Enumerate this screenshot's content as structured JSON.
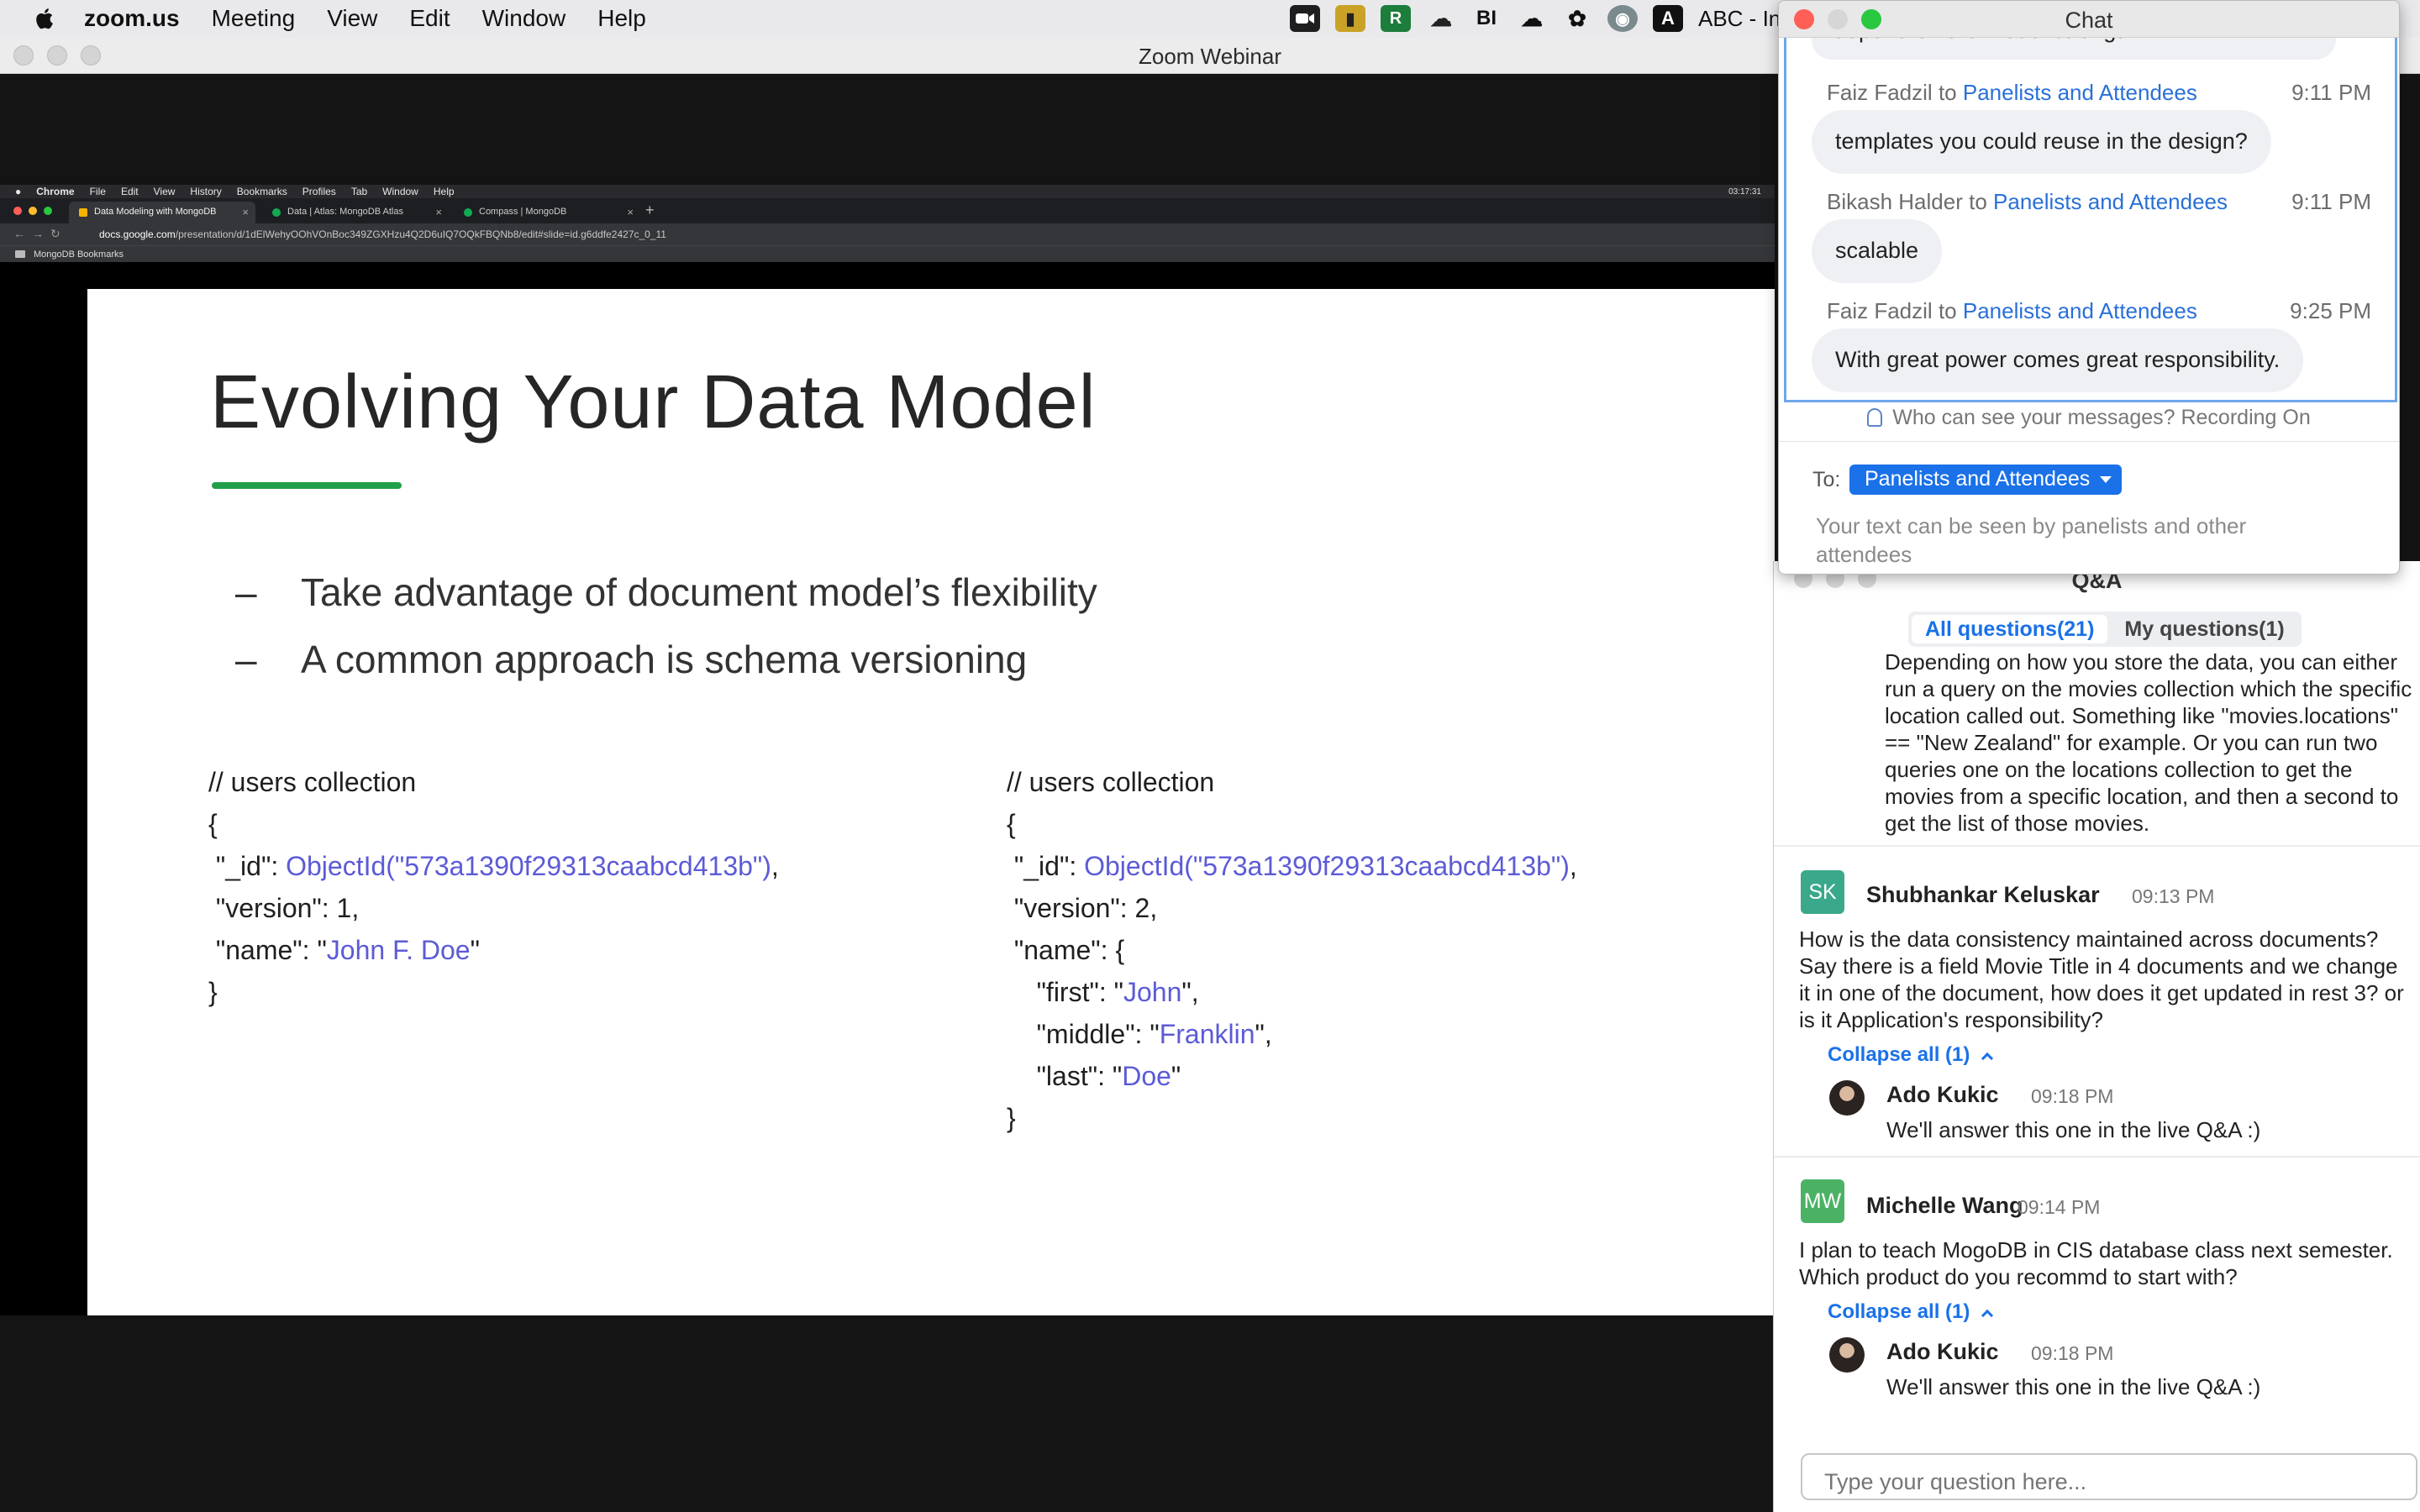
{
  "menubar": {
    "app": "zoom.us",
    "items": [
      "Meeting",
      "View",
      "Edit",
      "Window",
      "Help"
    ],
    "tray_icons": [
      "zoom-camera-icon",
      "shield-icon",
      "green-r-icon",
      "weather-icon",
      "bi-icon",
      "cloud-icon",
      "gear-badge-icon",
      "vpn-icon",
      "text-input-icon"
    ],
    "input_source": "ABC - In"
  },
  "zoom_window": {
    "title": "Zoom Webinar"
  },
  "chrome": {
    "menu": [
      "Chrome",
      "File",
      "Edit",
      "View",
      "History",
      "Bookmarks",
      "Profiles",
      "Tab",
      "Window",
      "Help"
    ],
    "clock": "03:17:31",
    "tabs": [
      {
        "label": "Data Modeling with MongoDB"
      },
      {
        "label": "Data | Atlas: MongoDB Atlas"
      },
      {
        "label": "Compass | MongoDB"
      }
    ],
    "url_host": "docs.google.com",
    "url_path": "/presentation/d/1dElWehyOOhVOnBoc349ZGXHzu4Q2D6uIQ7OQkFBQNb8/edit#slide=id.g6ddfe2427c_0_11",
    "bookmark": "MongoDB Bookmarks"
  },
  "slide": {
    "title": "Evolving Your Data Model",
    "bullets": [
      "Take advantage of document model’s flexibility",
      "A common approach is schema versioning"
    ],
    "left_code": {
      "comment": "// users collection",
      "open": "{",
      "id_key": " \"_id\": ",
      "id_val": "ObjectId(\"573a1390f29313caabcd413b\")",
      "version_line": " \"version\": 1,",
      "name_key": " \"name\": \"",
      "name_val": "John F. Doe",
      "quote": "\"",
      "close": "}"
    },
    "right_code": {
      "comment": "// users collection",
      "open": "{",
      "id_key": " \"_id\": ",
      "id_val": "ObjectId(\"573a1390f29313caabcd413b\")",
      "version_line": " \"version\": 2,",
      "name_open": " \"name\": {",
      "first_key": "    \"first\": \"",
      "first_val": "John",
      "middle_key": "    \"middle\": \"",
      "middle_val": "Franklin",
      "last_key": "    \"last\": \"",
      "last_val": "Doe",
      "comma_q": "\",",
      "q": "\"",
      "close": "}"
    }
  },
  "chat": {
    "title": "Chat",
    "prev_tail": "depend on the model strength",
    "messages": [
      {
        "sender": "Faiz Fadzil",
        "to_word": "to",
        "recipient": "Panelists and Attendees",
        "time": "9:11 PM",
        "text": "templates you could reuse in the design?"
      },
      {
        "sender": "Bikash Halder",
        "to_word": "to",
        "recipient": "Panelists and Attendees",
        "time": "9:11 PM",
        "text": "scalable"
      },
      {
        "sender": "Faiz Fadzil",
        "to_word": "to",
        "recipient": "Panelists and Attendees",
        "time": "9:25 PM",
        "text": "With great power comes great responsibility."
      }
    ],
    "visibility_note": "Who can see your messages? Recording On",
    "to_label": "To:",
    "to_value": "Panelists and Attendees",
    "placeholder": "Your text can be seen by panelists and other attendees"
  },
  "qa": {
    "title": "Q&A",
    "tabs": [
      "All questions(21)",
      "My questions(1)"
    ],
    "prev_answer": "Depending on how you store the data, you can either run a query on the movies collection which the specific location called out. Something like \"movies.locations\" == \"New Zealand\" for example. Or you can run two queries one on the locations collection to get the movies from a specific location, and then a second to get the list of those movies.",
    "questions": [
      {
        "initials": "SK",
        "avatar_color": "#3aa88a",
        "name": "Shubhankar Keluskar",
        "time": "09:13 PM",
        "text": "How is the data consistency maintained across documents? Say there is a field Movie Title in 4 documents and we change it in one of the document, how does it get updated in rest 3? or is it Application's responsibility?",
        "collapse": "Collapse all (1)",
        "reply": {
          "name": "Ado Kukic",
          "time": "09:18 PM",
          "text": "We'll answer this one in the live Q&A :)"
        }
      },
      {
        "initials": "MW",
        "avatar_color": "#4bb265",
        "name": "Michelle Wang",
        "time": "09:14 PM",
        "text": "I plan to teach MogoDB in CIS database class next semester. Which product do you recommd to start with?",
        "collapse": "Collapse all (1)",
        "reply": {
          "name": "Ado Kukic",
          "time": "09:18 PM",
          "text": "We'll answer this one in the live Q&A :)"
        }
      }
    ],
    "input_placeholder": "Type your question here..."
  },
  "colors": {
    "accent_blue": "#1a71e8",
    "slide_rule_green": "#21a049",
    "code_value": "#5c5bd6"
  }
}
